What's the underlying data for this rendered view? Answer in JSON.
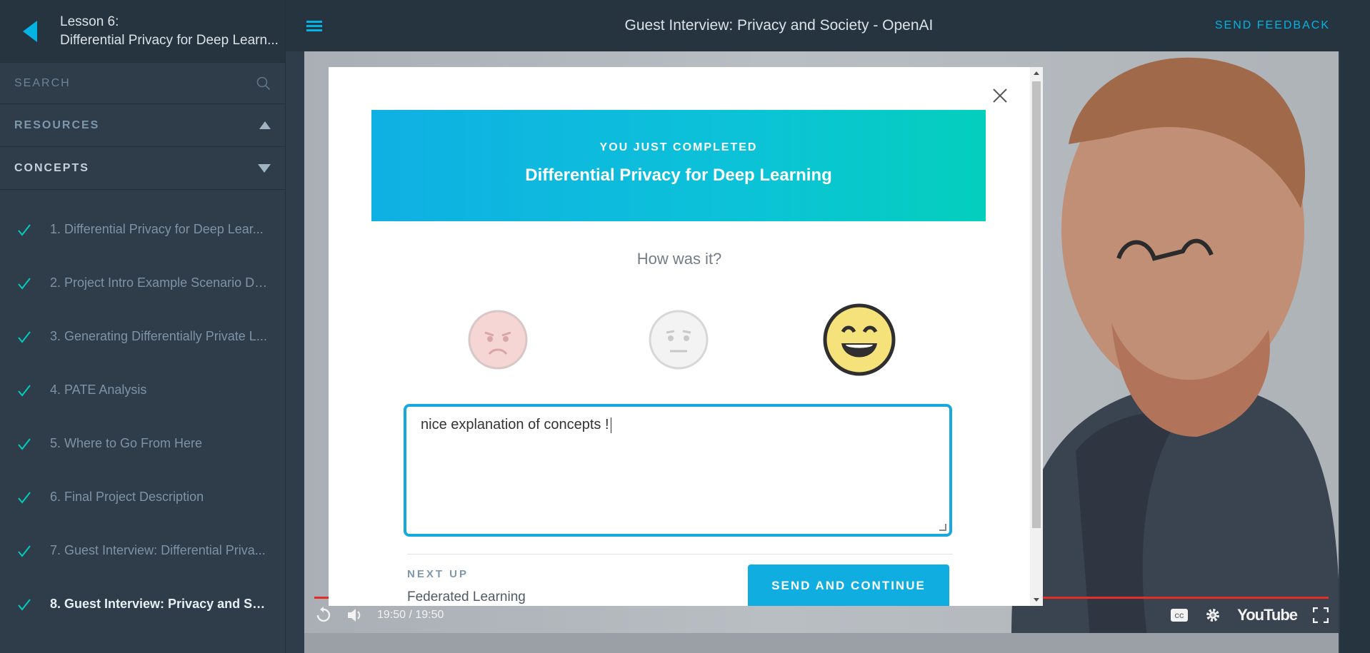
{
  "lesson": {
    "number_label": "Lesson 6:",
    "title": "Differential Privacy for Deep Learn..."
  },
  "sidebar": {
    "search_label": "SEARCH",
    "resources_label": "RESOURCES",
    "concepts_label": "CONCEPTS",
    "concepts": [
      {
        "label": "1. Differential Privacy for Deep Lear...",
        "completed": true
      },
      {
        "label": "2. Project Intro Example Scenario De...",
        "completed": true
      },
      {
        "label": "3. Generating Differentially Private L...",
        "completed": true
      },
      {
        "label": "4. PATE Analysis",
        "completed": true
      },
      {
        "label": "5. Where to Go From Here",
        "completed": true
      },
      {
        "label": "6. Final Project Description",
        "completed": true
      },
      {
        "label": "7. Guest Interview: Differential Priva...",
        "completed": true
      },
      {
        "label": "8. Guest Interview: Privacy and Soci...",
        "completed": true,
        "active": true
      }
    ]
  },
  "header": {
    "title": "Guest Interview: Privacy and Society - OpenAI",
    "feedback_label": "SEND FEEDBACK"
  },
  "video": {
    "time": "19:50 / 19:50",
    "progress_percent": 100,
    "brand": "YouTube"
  },
  "modal": {
    "kicker": "YOU JUST COMPLETED",
    "completed_title": "Differential Privacy for Deep Learning",
    "question": "How was it?",
    "ratings": [
      "sad-face-icon",
      "neutral-face-icon",
      "happy-face-icon"
    ],
    "selected_rating": "happy",
    "feedback_text": "nice explanation of concepts !",
    "next_up_label": "NEXT UP",
    "next_up_title": "Federated Learning",
    "send_label": "SEND AND CONTINUE"
  },
  "colors": {
    "accent": "#02b3e4",
    "sidebar_bg": "#2e3d49",
    "check": "#02ccba",
    "banner_start": "#0fb0e3",
    "banner_end": "#04cfbd"
  }
}
